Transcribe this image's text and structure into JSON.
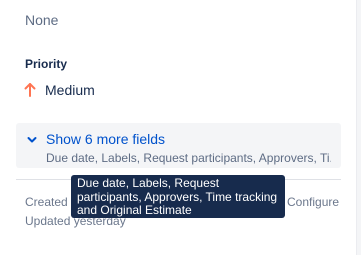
{
  "labels_field": {
    "value": "None"
  },
  "priority_field": {
    "label": "Priority",
    "value": "Medium",
    "icon": "arrow-up-icon",
    "icon_color": "#ff7452"
  },
  "more_fields": {
    "title": "Show 6 more fields",
    "summary": "Due date, Labels, Request participants, Approvers, Ti...",
    "icon": "chevron-down-icon",
    "link_color": "#0052cc"
  },
  "tooltip": {
    "text": "Due date, Labels, Request participants, Approvers, Time tracking and Original Estimate"
  },
  "footer": {
    "created": "Created 1",
    "configure_label": "Configure",
    "updated": "Updated yesterday"
  }
}
